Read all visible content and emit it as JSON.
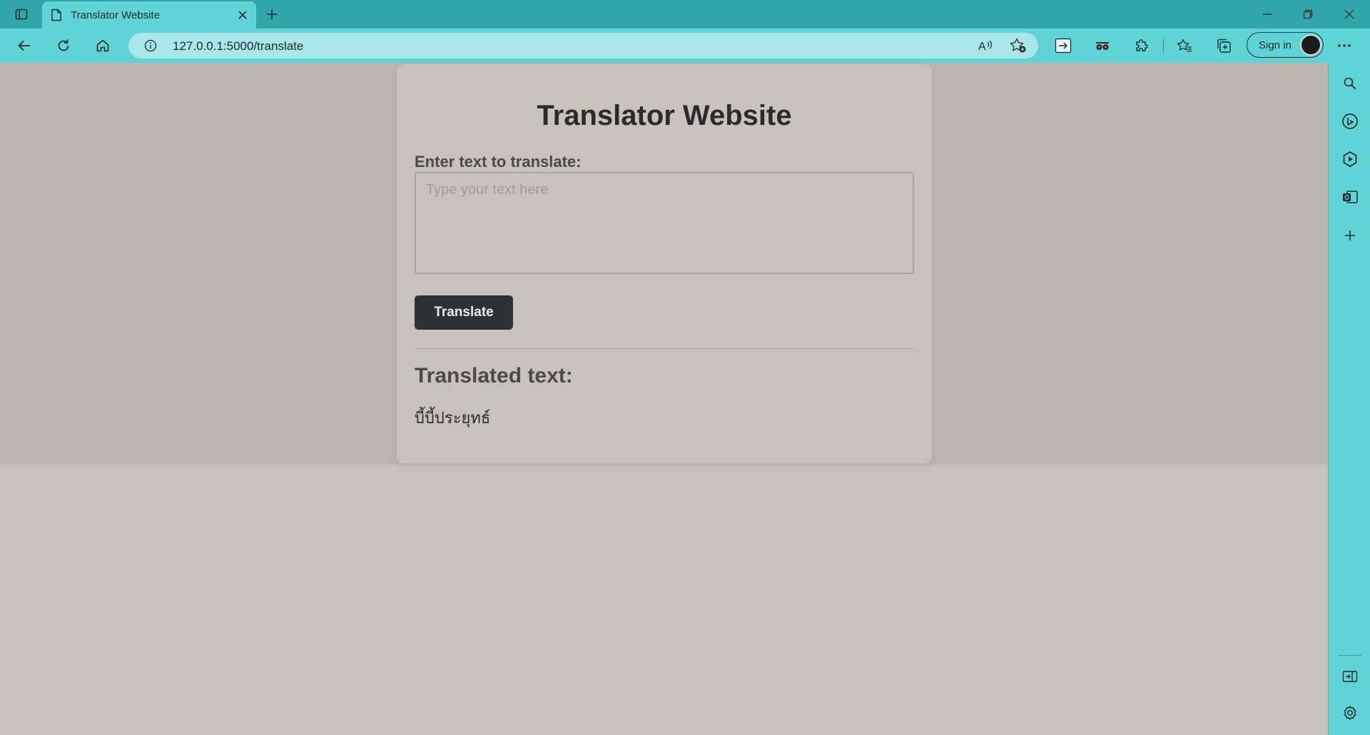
{
  "browser": {
    "tab_title": "Translator Website",
    "url": "127.0.0.1:5000/translate",
    "sign_in_label": "Sign in"
  },
  "page": {
    "title": "Translator Website",
    "input_label": "Enter text to translate:",
    "input_placeholder": "Type your text here",
    "input_value": "",
    "button_label": "Translate",
    "result_heading": "Translated text:",
    "result_text": "บี้บี้ประยุทธ์"
  },
  "icons": {
    "chrome": [
      "tab-actions-icon",
      "page-icon",
      "close-icon",
      "new-tab-icon",
      "minimize-icon",
      "restore-icon",
      "window-close-icon"
    ],
    "toolbar": [
      "back-icon",
      "refresh-icon",
      "home-icon",
      "info-icon",
      "read-aloud-icon",
      "add-favorite-icon",
      "extension-app-icon",
      "extension-eyes-icon",
      "extensions-icon",
      "favorites-icon",
      "collections-icon",
      "more-icon"
    ],
    "sidebar": [
      "search-icon",
      "copilot-icon",
      "games-icon",
      "outlook-icon",
      "add-icon",
      "hide-sidebar-icon",
      "settings-icon"
    ]
  },
  "colors": {
    "titlebar": "#31a6ab",
    "toolbar": "#5fd3d6",
    "address_bar": "#a8e6e8",
    "page_background": "#c8c2bc",
    "button": "#2f3235"
  }
}
